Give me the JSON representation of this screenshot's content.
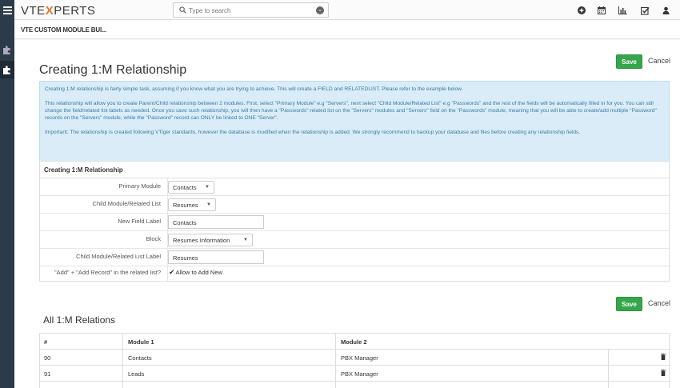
{
  "topbar": {
    "logo_prefix": "VTE",
    "logo_x": "X",
    "logo_suffix": "PERTS",
    "search_placeholder": "Type to search",
    "icons": [
      "add-icon",
      "calendar-icon",
      "reports-icon",
      "tasks-icon",
      "user-icon"
    ]
  },
  "module": {
    "title": "VTE CUSTOM MODULE BUI..."
  },
  "page": {
    "title": "Creating 1:M Relationship",
    "save_label": "Save",
    "cancel_label": "Cancel"
  },
  "info": {
    "p1": "Creating 1:M relationship is fairly simple task, assuming if you know what you are trying to achieve. This will create a FIELD and RELATEDLIST. Please refer to the example below.",
    "p2": "This relationship will allow you to create Parent/Child relationship between 2 modules. First, select \"Primary Module\" e.g \"Servers\", next select \"Child Module/Related List\" e.g \"Passwords\" and the rest of the fields will be automatically filled in for you. You can still change the field/related list labels as needed. Once you save such relationship, you will then have a \"Passwords\" related list on the \"Servers\" modules and \"Servers\" field on the \"Passwords\" module, meaning that you will be able to create/add multiple \"Password\" records on the \"Servers\" module, while the \"Password\" record can ONLY be linked to ONE \"Server\".",
    "p3": "Important: The relationship is created following VTiger standards, however the database is modified when the relationship is added. We strongly recommend to backup your database and files before creating any relationship fields."
  },
  "form": {
    "heading": "Creating 1:M Relationship",
    "primary_module_label": "Primary Module",
    "primary_module_value": "Contacts",
    "child_module_label": "Child Module/Related List",
    "child_module_value": "Resumes",
    "new_field_label": "New Field Label",
    "new_field_value": "Contacts",
    "block_label": "Block",
    "block_value": "Resumes Information",
    "child_list_label": "Child Module/Related List Label",
    "child_list_value": "Resumes",
    "add_record_label": "\"Add\" + \"Add Record\" in the related list?",
    "allow_add_label": "Allow to Add New",
    "allow_add_checked": true
  },
  "relations": {
    "title": "All 1:M Relations",
    "columns": [
      "#",
      "Module 1",
      "Module 2"
    ],
    "rows": [
      {
        "id": "90",
        "module1": "Contacts",
        "module2": "PBX Manager"
      },
      {
        "id": "91",
        "module1": "Leads",
        "module2": "PBX Manager"
      }
    ]
  },
  "colors": {
    "save_green": "#35a64a",
    "sidebar": "#2c3b49",
    "info_bg": "#d9ecf7",
    "info_text": "#3a7ca5",
    "logo_accent": "#e8742b"
  }
}
